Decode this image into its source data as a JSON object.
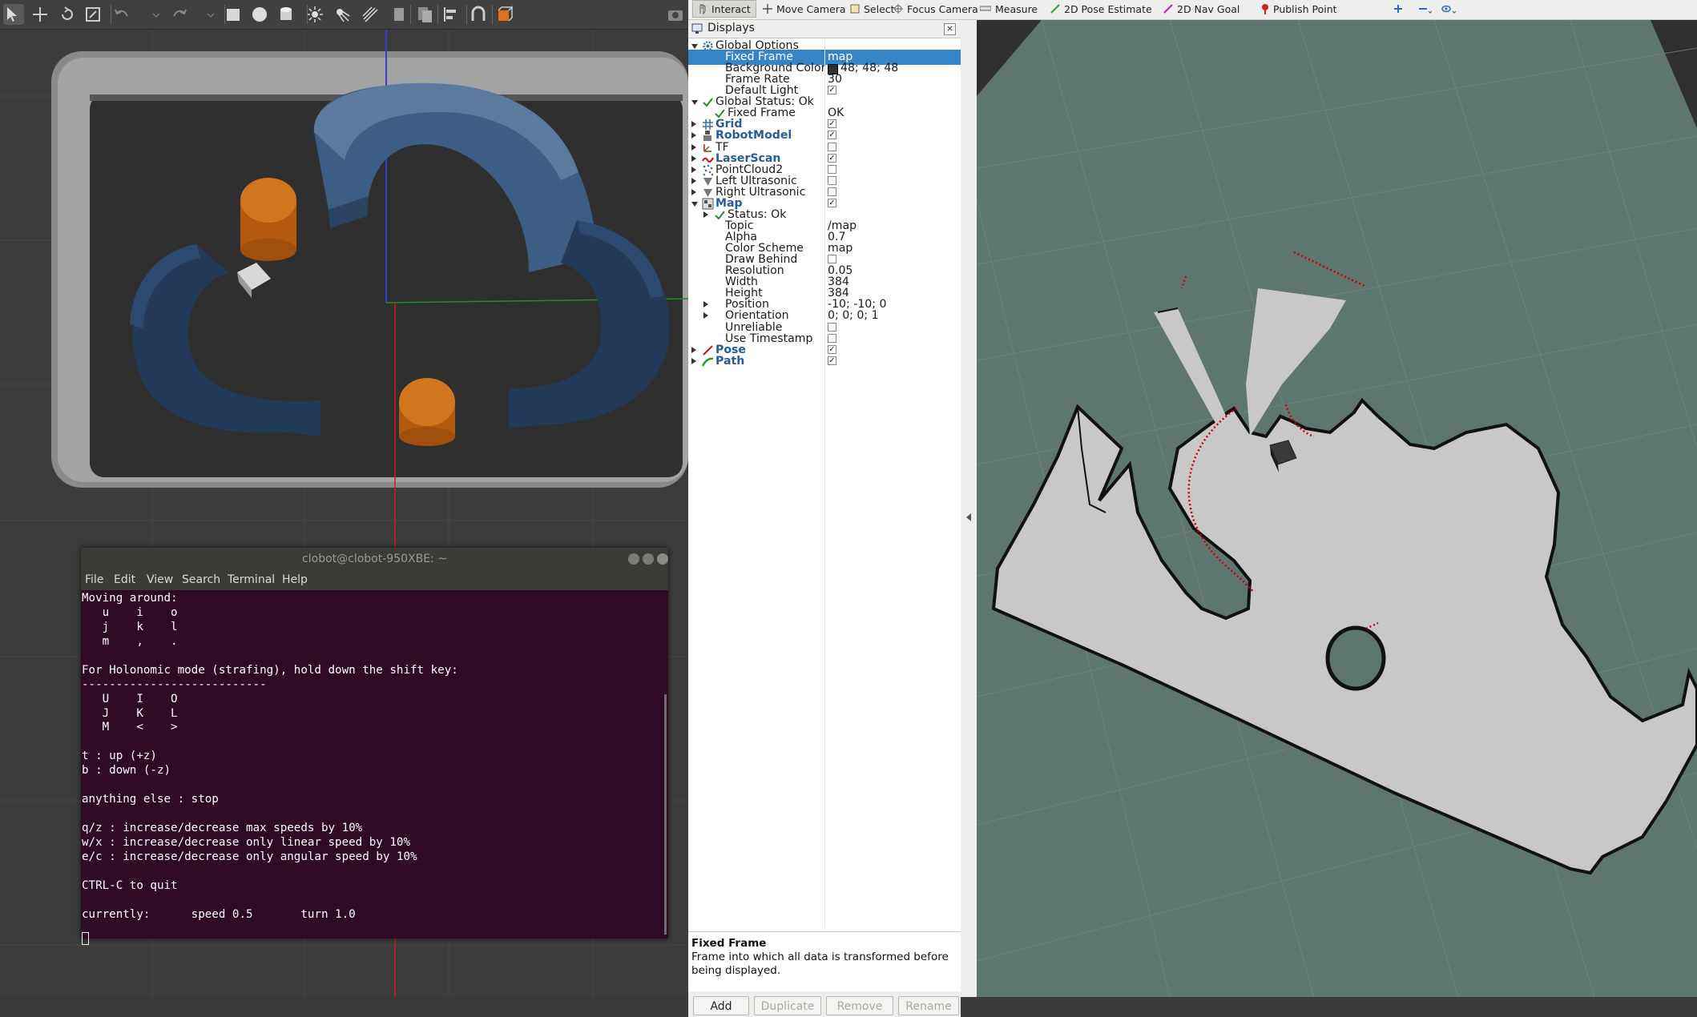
{
  "gazebo": {
    "toolbar_icons": [
      "select-arrow-icon",
      "translate-icon",
      "rotate-icon",
      "scale-icon",
      "undo-icon",
      "undo-dropdown-icon",
      "redo-icon",
      "redo-dropdown-icon",
      "box-icon",
      "sphere-icon",
      "cylinder-icon",
      "point-light-icon",
      "spot-light-icon",
      "directional-light-icon",
      "copy-icon",
      "paste-icon",
      "align-icon",
      "snap-icon",
      "view-angle-icon",
      "screenshot-icon"
    ]
  },
  "terminal": {
    "title": "clobot@clobot-950XBE: ~",
    "menu": [
      "File",
      "Edit",
      "View",
      "Search",
      "Terminal",
      "Help"
    ],
    "lines": [
      "Moving around:",
      "   u    i    o",
      "   j    k    l",
      "   m    ,    .",
      "",
      "For Holonomic mode (strafing), hold down the shift key:",
      "---------------------------",
      "   U    I    O",
      "   J    K    L",
      "   M    <    >",
      "",
      "t : up (+z)",
      "b : down (-z)",
      "",
      "anything else : stop",
      "",
      "q/z : increase/decrease max speeds by 10%",
      "w/x : increase/decrease only linear speed by 10%",
      "e/c : increase/decrease only angular speed by 10%",
      "",
      "CTRL-C to quit",
      "",
      "currently:      speed 0.5       turn 1.0"
    ]
  },
  "rviz": {
    "toolbar": [
      {
        "label": "Interact",
        "icon": "interact-hand-icon",
        "active": true
      },
      {
        "label": "Move Camera",
        "icon": "move-camera-icon",
        "active": false
      },
      {
        "label": "Select",
        "icon": "select-box-icon",
        "active": false
      },
      {
        "label": "Focus Camera",
        "icon": "focus-camera-icon",
        "active": false
      },
      {
        "label": "Measure",
        "icon": "measure-ruler-icon",
        "active": false
      },
      {
        "label": "2D Pose Estimate",
        "icon": "pose-estimate-arrow-icon",
        "active": false
      },
      {
        "label": "2D Nav Goal",
        "icon": "nav-goal-arrow-icon",
        "active": false
      },
      {
        "label": "Publish Point",
        "icon": "publish-point-pin-icon",
        "active": false
      }
    ],
    "displays_title": "Displays",
    "rows": [
      {
        "name": "Global Options",
        "value": "",
        "indent": 0,
        "arrow": "down",
        "icon": "gear-icon",
        "bold": false
      },
      {
        "name": "Fixed Frame",
        "value": "map",
        "indent": 1,
        "arrow": "",
        "icon": "",
        "bold": false,
        "selected": true
      },
      {
        "name": "Background Color",
        "value": "48; 48; 48",
        "indent": 1,
        "arrow": "",
        "icon": "",
        "bold": false,
        "swatch": "#303030"
      },
      {
        "name": "Frame Rate",
        "value": "30",
        "indent": 1,
        "arrow": "",
        "icon": "",
        "bold": false
      },
      {
        "name": "Default Light",
        "value": "",
        "indent": 1,
        "arrow": "",
        "icon": "",
        "bold": false,
        "check": true
      },
      {
        "name": "Global Status: Ok",
        "value": "",
        "indent": 0,
        "arrow": "down",
        "icon": "ok-check-icon",
        "bold": false
      },
      {
        "name": "Fixed Frame",
        "value": "OK",
        "indent": 1,
        "arrow": "",
        "icon": "ok-check-icon",
        "bold": false
      },
      {
        "name": "Grid",
        "value": "",
        "indent": 0,
        "arrow": "right",
        "icon": "grid-icon",
        "bold": true,
        "check": true
      },
      {
        "name": "RobotModel",
        "value": "",
        "indent": 0,
        "arrow": "right",
        "icon": "robot-model-icon",
        "bold": true,
        "check": true
      },
      {
        "name": "TF",
        "value": "",
        "indent": 0,
        "arrow": "right",
        "icon": "tf-axes-icon",
        "bold": false,
        "check": false
      },
      {
        "name": "LaserScan",
        "value": "",
        "indent": 0,
        "arrow": "right",
        "icon": "laser-scan-icon",
        "bold": true,
        "check": true
      },
      {
        "name": "PointCloud2",
        "value": "",
        "indent": 0,
        "arrow": "right",
        "icon": "point-cloud-icon",
        "bold": false,
        "check": false
      },
      {
        "name": "Left Ultrasonic",
        "value": "",
        "indent": 0,
        "arrow": "right",
        "icon": "range-cone-icon",
        "bold": false,
        "check": false
      },
      {
        "name": "Right Ultrasonic",
        "value": "",
        "indent": 0,
        "arrow": "right",
        "icon": "range-cone-icon",
        "bold": false,
        "check": false
      },
      {
        "name": "Map",
        "value": "",
        "indent": 0,
        "arrow": "down",
        "icon": "map-icon",
        "bold": true,
        "check": true
      },
      {
        "name": "Status: Ok",
        "value": "",
        "indent": 1,
        "arrow": "right",
        "icon": "ok-check-icon",
        "bold": false
      },
      {
        "name": "Topic",
        "value": "/map",
        "indent": 1,
        "arrow": "",
        "icon": "",
        "bold": false
      },
      {
        "name": "Alpha",
        "value": "0.7",
        "indent": 1,
        "arrow": "",
        "icon": "",
        "bold": false
      },
      {
        "name": "Color Scheme",
        "value": "map",
        "indent": 1,
        "arrow": "",
        "icon": "",
        "bold": false
      },
      {
        "name": "Draw Behind",
        "value": "",
        "indent": 1,
        "arrow": "",
        "icon": "",
        "bold": false,
        "check": false
      },
      {
        "name": "Resolution",
        "value": "0.05",
        "indent": 1,
        "arrow": "",
        "icon": "",
        "bold": false
      },
      {
        "name": "Width",
        "value": "384",
        "indent": 1,
        "arrow": "",
        "icon": "",
        "bold": false
      },
      {
        "name": "Height",
        "value": "384",
        "indent": 1,
        "arrow": "",
        "icon": "",
        "bold": false
      },
      {
        "name": "Position",
        "value": "-10; -10; 0",
        "indent": 1,
        "arrow": "right",
        "icon": "",
        "bold": false
      },
      {
        "name": "Orientation",
        "value": "0; 0; 0; 1",
        "indent": 1,
        "arrow": "right",
        "icon": "",
        "bold": false
      },
      {
        "name": "Unreliable",
        "value": "",
        "indent": 1,
        "arrow": "",
        "icon": "",
        "bold": false,
        "check": false
      },
      {
        "name": "Use Timestamp",
        "value": "",
        "indent": 1,
        "arrow": "",
        "icon": "",
        "bold": false,
        "check": false
      },
      {
        "name": "Pose",
        "value": "",
        "indent": 0,
        "arrow": "right",
        "icon": "pose-arrow-icon",
        "bold": true,
        "check": true
      },
      {
        "name": "Path",
        "value": "",
        "indent": 0,
        "arrow": "right",
        "icon": "path-icon",
        "bold": true,
        "check": true
      }
    ],
    "description": {
      "title": "Fixed Frame",
      "text": "Frame into which all data is transformed before being displayed."
    },
    "buttons": [
      {
        "label": "Add",
        "enabled": true
      },
      {
        "label": "Duplicate",
        "enabled": false
      },
      {
        "label": "Remove",
        "enabled": false
      },
      {
        "label": "Rename",
        "enabled": false
      }
    ],
    "colors": {
      "background": "#303030",
      "map_free": "#c8c8c8",
      "map_unknown": "#5e7570",
      "laser": "#cc0000"
    }
  }
}
